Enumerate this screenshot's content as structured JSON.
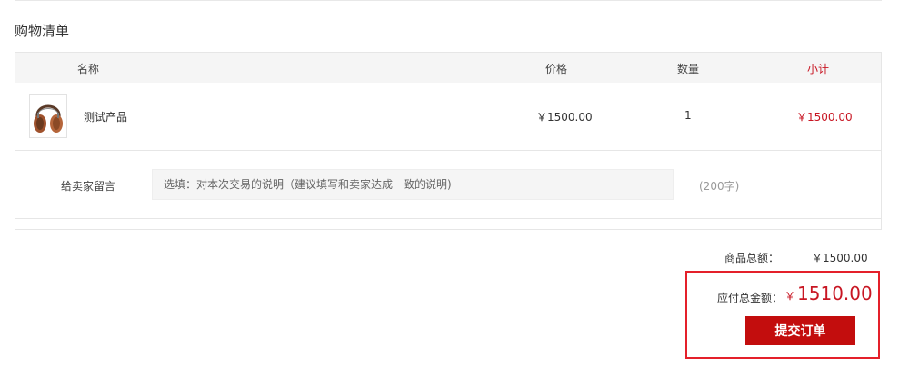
{
  "section_title": "购物清单",
  "table": {
    "headers": {
      "name": "名称",
      "price": "价格",
      "quantity": "数量",
      "subtotal": "小计"
    },
    "items": [
      {
        "image_icon": "headphones-image",
        "name": "测试产品",
        "price": "￥1500.00",
        "quantity": "1",
        "subtotal": "￥1500.00"
      }
    ]
  },
  "message": {
    "label": "给卖家留言",
    "placeholder": "选填：对本次交易的说明（建议填写和卖家达成一致的说明)",
    "limit": "(200字)"
  },
  "summary": {
    "goods_total_label": "商品总额：",
    "goods_total_value": "￥1500.00",
    "payable_label": "应付总金额：",
    "payable_currency": "￥",
    "payable_amount": "1510.00",
    "submit_label": "提交订单"
  },
  "colors": {
    "accent_red": "#c81623",
    "button_red": "#c30d0d",
    "highlight_border": "#e4202a",
    "header_bg": "#f5f5f5"
  }
}
